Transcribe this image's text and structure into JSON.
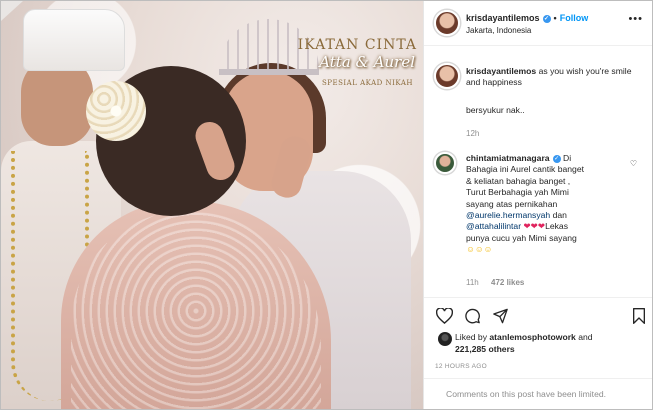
{
  "post": {
    "username": "krisdayantilemos",
    "follow_label": "Follow",
    "location": "Jakarta, Indonesia",
    "more_icon": "ellipsis-icon",
    "image_overlay": {
      "line1": "IKATAN CINTA",
      "line2": "Atta & Aurel",
      "line3": "SPESIAL AKAD NIKAH"
    }
  },
  "caption": {
    "username": "krisdayantilemos",
    "text": "as you wish you're smile and happiness",
    "extra": "bersyukur nak..",
    "time": "12h"
  },
  "comment": {
    "username": "chintamiatmanagara",
    "lines": [
      "Di",
      "Bahagia ini Aurel cantik banget",
      "& keliatan bahagia banget ,",
      "Turut Berbahagia yah Mimi",
      "sayang atas pernikahan",
      "dan",
      "Lekas",
      "punya cucu yah Mimi sayang"
    ],
    "mentions": [
      "@aurelie.hermansyah",
      "@attahalilintar"
    ],
    "time": "11h",
    "likes": "472 likes"
  },
  "likes": {
    "prefix": "Liked by",
    "user": "atanlemosphotowork",
    "and": "and",
    "count": "221,285 others"
  },
  "posted_ago": "12 HOURS AGO",
  "comments_limited": "Comments on this post have been limited.",
  "icons": {
    "like": "heart-icon",
    "comment": "comment-icon",
    "share": "share-icon",
    "save": "bookmark-icon"
  },
  "colors": {
    "link": "#0095f6",
    "verified": "#3897f0",
    "mention": "#00376b",
    "muted": "#8e8e8e"
  }
}
